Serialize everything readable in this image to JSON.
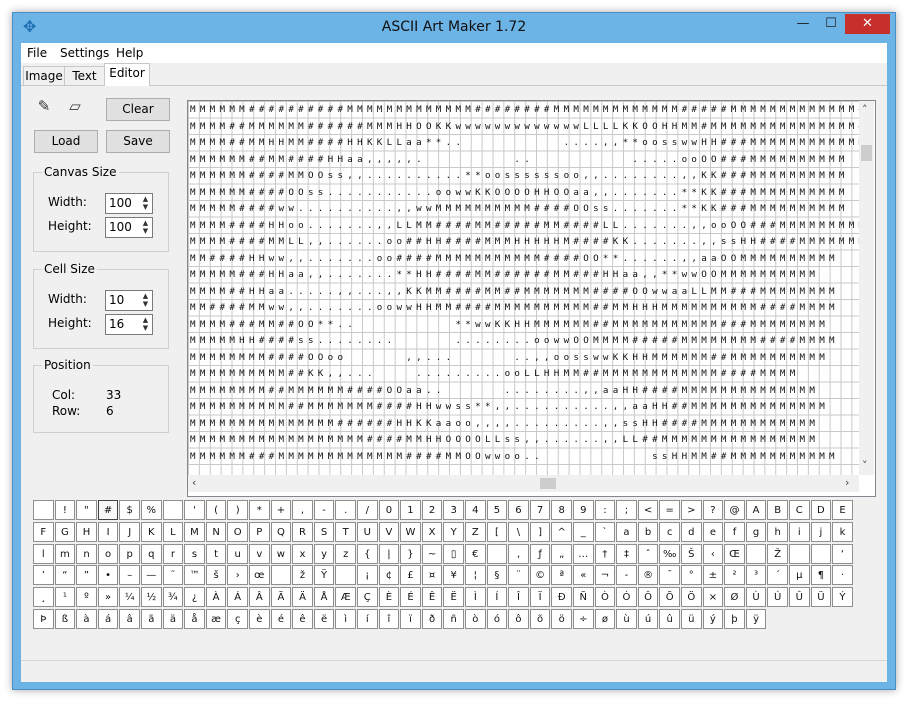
{
  "window": {
    "title": "ASCII Art Maker 1.72"
  },
  "menu": [
    "File",
    "Settings",
    "Help"
  ],
  "tabs": [
    "Image",
    "Text",
    "Editor"
  ],
  "buttons": {
    "clear": "Clear",
    "load": "Load",
    "save": "Save"
  },
  "tools": {
    "pencil": "pencil-icon",
    "eraser": "eraser-icon"
  },
  "canvas_size": {
    "title": "Canvas Size",
    "width_label": "Width:",
    "width": "100",
    "height_label": "Height:",
    "height": "100"
  },
  "cell_size": {
    "title": "Cell Size",
    "width_label": "Width:",
    "width": "10",
    "height_label": "Height:",
    "height": "16"
  },
  "position": {
    "title": "Position",
    "col_label": "Col:",
    "col": "33",
    "row_label": "Row:",
    "row": "6"
  },
  "canvas_rows": [
    "MMMMMM##########MMMMMMMMMMMMM########MMMMMMMMMMMMM#####MMMMMMMMMMMMM####",
    "MMMM##MMMMMM######MMMHHOOKKwwwwwwwwwwwwwLLLLKKOOHHMM#MMMMMMMMMMMMMMM###",
    "MMMM##MMHHMM####HHKKLLaa**..          ....,,**oosswwHH###MMMMMMMMMMMM",
    "MMMMMM##MM####HHaa,,,,,.         ..          .....ooOO###MMMMMMMMMM",
    "MMMMMM####MMOOss,,..........**oossssssoo,,........,,KK###MMMMMMMMMM",
    "MMMMMM####OOss...........oowwKKOOOOHHOOaa,,.......**KK###MMMMMMMMMM",
    "MMMMM####ww..........,,wwMMMMMMMMMM####OOss.......**KK###MMMMMMMMMM",
    "MMMM####HHoo.......,,LLMM####MM#####MM####LL.......,,ooOO###MMMMMMMMM",
    "MMMM####MMLL,,......oo##HH####MMMHHHHHM####KK.......,,ssHH####MMMMMMMM",
    "MM####HHww,,.......oo####MMMMMMMMMMM####OO**......,,aaOOMMMMMMMMMM",
    "MMMMM###HHaa,,.......**HH####MM######MM###HHaa,,**wwOOMMMMMMMMMM",
    "MMMM##HHaa.....,,...,,KKMM####MM##MMMMMMM####OOwwaaLLMM###MMMMMMMM",
    "MM####MMww,,.......oowwHHMM####MMMMMMMMMM##MMHHHMMMMMMMMMM####MMMM",
    "MMMM###MM##OO**..          **wwKKHHMMMMMM##MMMMMMMMMMM###MMMMMMMM",
    "MMMMMHH####ss........      ........oowwOOMMMM#####MMMMMMMM####MMMM",
    "MMMMMMMM####OOoo      ,,...      ..,,oosswwKKHHMMMMMM##MMMMMMMMMM",
    "MMMMMMMMMM##KK,,...    .........ooLLHHMM##MMMMMMMMMMMM####MMMM",
    "MMMMMMMM##MMMMMM####OOaa..      ........,,aaHH####MMMMMMMMMMMMMM",
    "MMMMMMMMMM##MMMMMMM####HHwwss**,,..........,,aaHH##MMMMMMMMMMMMMM",
    "MMMMMMMMMMMMMMM######HHKKaaoo,,,,.........,,ssHH####MMMMMMMMMMMM",
    "MMMMMMMMMMMMMMMMMM####MMHHOOOOLLss,,......,,LL##MMMMMMMMMMMMMMMM",
    "MMMMMM###MMMMMMMMMMMMM####MMOOwwoo..           ssHHMM##MMMMMMMMMMM"
  ],
  "char_rows": [
    [
      " ",
      "!",
      "\"",
      "#",
      "$",
      "%",
      " ",
      "'",
      "(",
      ")",
      "*",
      "+",
      ",",
      "-",
      ".",
      "/",
      "0",
      "1",
      "2",
      "3",
      "4",
      "5",
      "6",
      "7",
      "8",
      "9",
      ":",
      ";",
      "<",
      "=",
      ">",
      "?",
      "@",
      "A",
      "B",
      "C",
      "D",
      "E"
    ],
    [
      "F",
      "G",
      "H",
      "I",
      "J",
      "K",
      "L",
      "M",
      "N",
      "O",
      "P",
      "Q",
      "R",
      "S",
      "T",
      "U",
      "V",
      "W",
      "X",
      "Y",
      "Z",
      "[",
      "\\",
      "]",
      "^",
      "_",
      "`",
      "a",
      "b",
      "c",
      "d",
      "e",
      "f",
      "g",
      "h",
      "i",
      "j",
      "k"
    ],
    [
      "l",
      "m",
      "n",
      "o",
      "p",
      "q",
      "r",
      "s",
      "t",
      "u",
      "v",
      "w",
      "x",
      "y",
      "z",
      "{",
      "|",
      "}",
      "~",
      "▯",
      "€",
      " ",
      "‚",
      "ƒ",
      "„",
      "…",
      "†",
      "‡",
      "ˆ",
      "‰",
      "Š",
      "‹",
      "Œ",
      " ",
      "Ž",
      " ",
      " ",
      "‘"
    ],
    [
      "’",
      "“",
      "”",
      "•",
      "–",
      "—",
      "˜",
      "™",
      "š",
      "›",
      "œ",
      " ",
      "ž",
      "Ÿ",
      " ",
      "¡",
      "¢",
      "£",
      "¤",
      "¥",
      "¦",
      "§",
      "¨",
      "©",
      "ª",
      "«",
      "¬",
      "-",
      "®",
      "¯",
      "°",
      "±",
      "²",
      "³",
      "´",
      "µ",
      "¶",
      "·"
    ],
    [
      "¸",
      "¹",
      "º",
      "»",
      "¼",
      "½",
      "¾",
      "¿",
      "À",
      "Á",
      "Â",
      "Ã",
      "Ä",
      "Å",
      "Æ",
      "Ç",
      "È",
      "É",
      "Ê",
      "Ë",
      "Ì",
      "Í",
      "Î",
      "Ï",
      "Ð",
      "Ñ",
      "Ò",
      "Ó",
      "Ô",
      "Õ",
      "Ö",
      "×",
      "Ø",
      "Ù",
      "Ú",
      "Û",
      "Ü",
      "Ý"
    ],
    [
      "Þ",
      "ß",
      "à",
      "á",
      "â",
      "ã",
      "ä",
      "å",
      "æ",
      "ç",
      "è",
      "é",
      "ê",
      "ë",
      "ì",
      "í",
      "î",
      "ï",
      "ð",
      "ñ",
      "ò",
      "ó",
      "ô",
      "õ",
      "ö",
      "÷",
      "ø",
      "ù",
      "ú",
      "û",
      "ü",
      "ý",
      "þ",
      "ÿ"
    ]
  ],
  "selected_char": "#"
}
